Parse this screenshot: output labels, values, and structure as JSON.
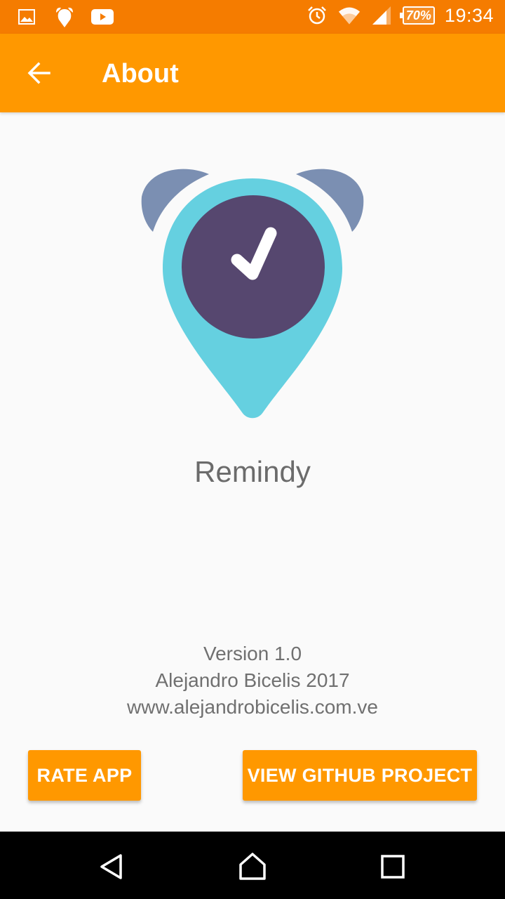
{
  "status_bar": {
    "left_icons": [
      "gallery-icon",
      "alarm-app-icon",
      "youtube-icon"
    ],
    "right_icons": [
      "alarm-clock-icon",
      "wifi-icon",
      "signal-icon"
    ],
    "battery": "70%",
    "time": "19:34"
  },
  "app_bar": {
    "back_icon": "arrow-back-icon",
    "title": "About"
  },
  "logo": {
    "colors": {
      "ears": "#7b8fb2",
      "pin": "#65d0e0",
      "face": "#56476f",
      "check": "#ffffff"
    }
  },
  "app_name": "Remindy",
  "info": {
    "version": "Version 1.0",
    "author": "Alejandro Bicelis 2017",
    "website": "www.alejandrobicelis.com.ve"
  },
  "buttons": {
    "rate": "RATE APP",
    "github": "VIEW GITHUB PROJECT"
  },
  "nav_bar": {
    "icons": [
      "back-triangle-icon",
      "home-icon",
      "recents-icon"
    ]
  },
  "colors": {
    "status_bar": "#f57c00",
    "app_bar": "#ff9800",
    "background": "#fafafa",
    "accent": "#ff9800"
  }
}
